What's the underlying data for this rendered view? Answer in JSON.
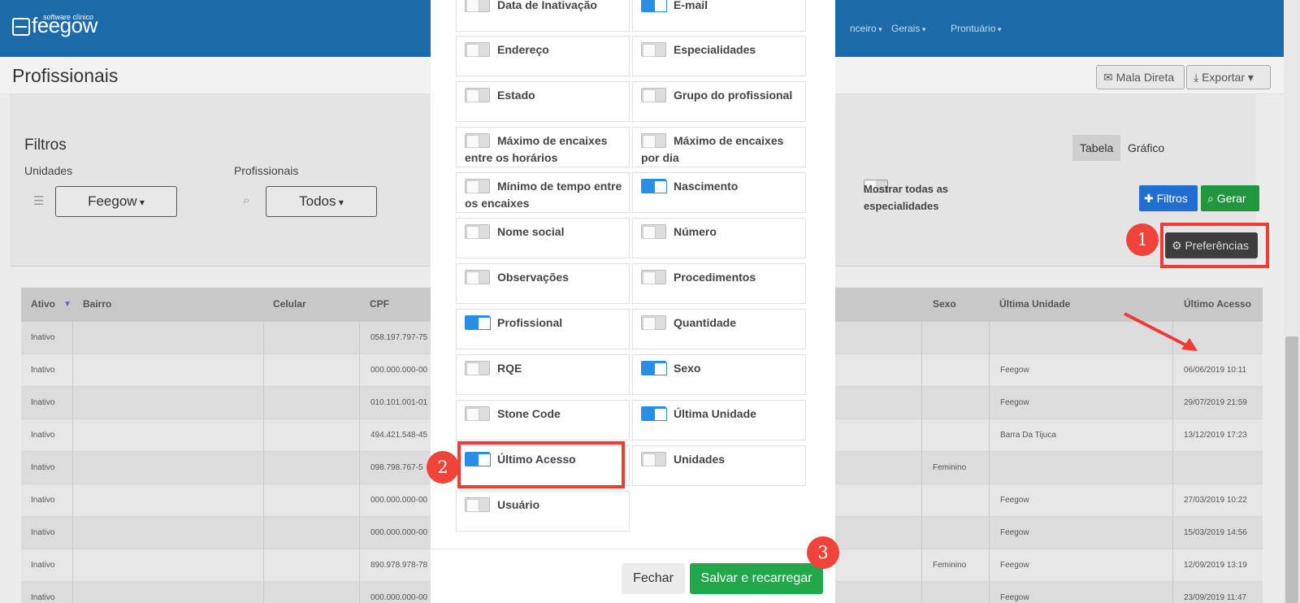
{
  "brand": {
    "name": "feegow",
    "tagline": "software clínico"
  },
  "nav": [
    "nceiro",
    "Gerais",
    "Prontuário"
  ],
  "page": {
    "title": "Profissionais",
    "buttons": {
      "mailing": "Mala Direta",
      "export": "Exportar"
    }
  },
  "filters": {
    "title": "Filtros",
    "units_label": "Unidades",
    "units_value": "Feegow",
    "professionals_label": "Profissionais",
    "professionals_value": "Todos",
    "view_tabs": [
      "Tabela",
      "Gráfico"
    ],
    "show_all_label": "Mostrar todas as especialidades",
    "filters_button": "Filtros",
    "generate_button": "Gerar",
    "preferences_button": "Preferências"
  },
  "table": {
    "headers": [
      "Ativo",
      "Bairro",
      "Celular",
      "CPF",
      "Sexo",
      "Última Unidade",
      "Último Acesso"
    ],
    "rows": [
      {
        "ativo": "Inativo",
        "cpf": "058.197.797-75",
        "sexo": "",
        "unidade": "",
        "acesso": ""
      },
      {
        "ativo": "Inativo",
        "cpf": "000.000.000-00",
        "sexo": "",
        "unidade": "Feegow",
        "acesso": "06/06/2019 10:11"
      },
      {
        "ativo": "Inativo",
        "cpf": "010.101.001-01",
        "sexo": "",
        "unidade": "Feegow",
        "acesso": "29/07/2019 21:59"
      },
      {
        "ativo": "Inativo",
        "cpf": "494.421.548-45",
        "sexo": "",
        "unidade": "Barra Da Tijuca",
        "acesso": "13/12/2019 17:23"
      },
      {
        "ativo": "Inativo",
        "cpf": "098.798.767-5",
        "sexo": "Feminino",
        "unidade": "",
        "acesso": ""
      },
      {
        "ativo": "Inativo",
        "cpf": "000.000.000-00",
        "sexo": "",
        "unidade": "Feegow",
        "acesso": "27/03/2019 10:22"
      },
      {
        "ativo": "Inativo",
        "cpf": "000.000.000-00",
        "sexo": "",
        "unidade": "Feegow",
        "acesso": "15/03/2019 14:56"
      },
      {
        "ativo": "Inativo",
        "cpf": "890.978.978-78",
        "sexo": "Feminino",
        "unidade": "Feegow",
        "acesso": "12/09/2019 13:19"
      },
      {
        "ativo": "Inativo",
        "cpf": "000.000.000-00",
        "sexo": "",
        "unidade": "Feegow",
        "acesso": "23/09/2019 11:47"
      }
    ]
  },
  "modal": {
    "options": [
      {
        "label": "Data de Inativação",
        "on": false
      },
      {
        "label": "E-mail",
        "on": true
      },
      {
        "label": "Endereço",
        "on": false
      },
      {
        "label": "Especialidades",
        "on": false
      },
      {
        "label": "Estado",
        "on": false
      },
      {
        "label": "Grupo do profissional",
        "on": false
      },
      {
        "label": "Máximo de encaixes entre os horários",
        "on": false
      },
      {
        "label": "Máximo de encaixes por dia",
        "on": false
      },
      {
        "label": "Mínimo de tempo entre os encaixes",
        "on": false
      },
      {
        "label": "Nascimento",
        "on": true
      },
      {
        "label": "Nome social",
        "on": false
      },
      {
        "label": "Número",
        "on": false
      },
      {
        "label": "Observações",
        "on": false
      },
      {
        "label": "Procedimentos",
        "on": false
      },
      {
        "label": "Profissional",
        "on": true
      },
      {
        "label": "Quantidade",
        "on": false
      },
      {
        "label": "RQE",
        "on": false
      },
      {
        "label": "Sexo",
        "on": true
      },
      {
        "label": "Stone Code",
        "on": false
      },
      {
        "label": "Última Unidade",
        "on": true
      },
      {
        "label": "Último Acesso",
        "on": true
      },
      {
        "label": "Unidades",
        "on": false
      },
      {
        "label": "Usuário",
        "on": false
      }
    ],
    "close_button": "Fechar",
    "save_button": "Salvar e recarregar"
  },
  "annotations": [
    "1",
    "2",
    "3"
  ],
  "colors": {
    "topbar": "#1c6aa8",
    "toggle_on": "#2b8ee6",
    "save": "#22a84a",
    "annotation": "#f0433a"
  },
  "icons": [
    "menu-icon",
    "search-icon",
    "envelope-icon",
    "download-icon",
    "plus-icon",
    "gear-icon"
  ]
}
